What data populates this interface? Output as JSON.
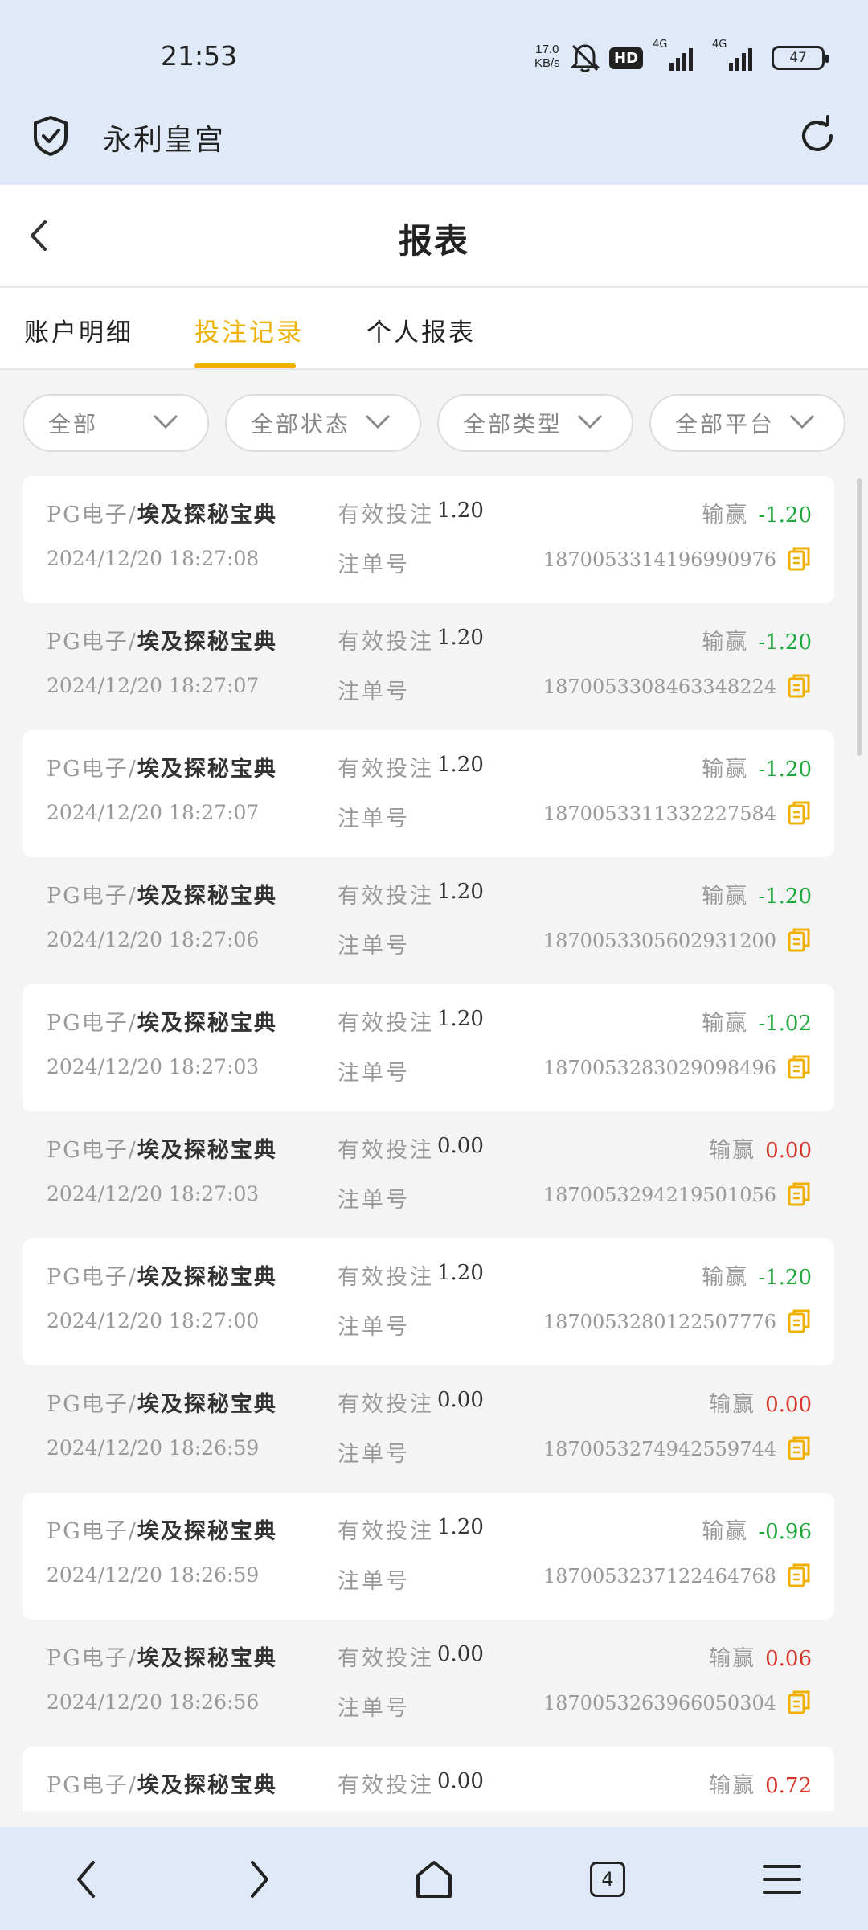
{
  "status_bar": {
    "time": "21:53",
    "net_speed_value": "17.0",
    "net_speed_unit": "KB/s",
    "hd_badge": "HD",
    "signal1": "4G",
    "signal2": "4G",
    "battery": "47"
  },
  "browser": {
    "site_title": "永利皇宫"
  },
  "page": {
    "title": "报表"
  },
  "tabs": [
    {
      "label": "账户明细",
      "active": false
    },
    {
      "label": "投注记录",
      "active": true
    },
    {
      "label": "个人报表",
      "active": false
    }
  ],
  "filters": [
    {
      "label": "全部"
    },
    {
      "label": "全部状态"
    },
    {
      "label": "全部类型"
    },
    {
      "label": "全部平台"
    }
  ],
  "labels": {
    "valid_bet": "有效投注",
    "order_no": "注单号",
    "win_loss": "输赢"
  },
  "records": [
    {
      "platform": "PG电子/",
      "game": "埃及探秘宝典",
      "time": "2024/12/20  18:27:08",
      "bet": "1.20",
      "result": "-1.20",
      "order": "1870053314196990976"
    },
    {
      "platform": "PG电子/",
      "game": "埃及探秘宝典",
      "time": "2024/12/20  18:27:07",
      "bet": "1.20",
      "result": "-1.20",
      "order": "1870053308463348224"
    },
    {
      "platform": "PG电子/",
      "game": "埃及探秘宝典",
      "time": "2024/12/20  18:27:07",
      "bet": "1.20",
      "result": "-1.20",
      "order": "1870053311332227584"
    },
    {
      "platform": "PG电子/",
      "game": "埃及探秘宝典",
      "time": "2024/12/20  18:27:06",
      "bet": "1.20",
      "result": "-1.20",
      "order": "1870053305602931200"
    },
    {
      "platform": "PG电子/",
      "game": "埃及探秘宝典",
      "time": "2024/12/20  18:27:03",
      "bet": "1.20",
      "result": "-1.02",
      "order": "1870053283029098496"
    },
    {
      "platform": "PG电子/",
      "game": "埃及探秘宝典",
      "time": "2024/12/20  18:27:03",
      "bet": "0.00",
      "result": "0.00",
      "order": "1870053294219501056"
    },
    {
      "platform": "PG电子/",
      "game": "埃及探秘宝典",
      "time": "2024/12/20  18:27:00",
      "bet": "1.20",
      "result": "-1.20",
      "order": "1870053280122507776"
    },
    {
      "platform": "PG电子/",
      "game": "埃及探秘宝典",
      "time": "2024/12/20  18:26:59",
      "bet": "0.00",
      "result": "0.00",
      "order": "1870053274942559744"
    },
    {
      "platform": "PG电子/",
      "game": "埃及探秘宝典",
      "time": "2024/12/20  18:26:59",
      "bet": "1.20",
      "result": "-0.96",
      "order": "1870053237122464768"
    },
    {
      "platform": "PG电子/",
      "game": "埃及探秘宝典",
      "time": "2024/12/20  18:26:56",
      "bet": "0.00",
      "result": "0.06",
      "order": "1870053263966050304"
    },
    {
      "platform": "PG电子/",
      "game": "埃及探秘宝典",
      "time": "",
      "bet": "0.00",
      "result": "0.72",
      "order": ""
    }
  ],
  "bottom_nav": {
    "tab_count": "4"
  },
  "colors": {
    "accent": "#f0b000",
    "positive": "#d9342b",
    "negative": "#1ea83b",
    "chrome_bg": "#dfe9f8"
  }
}
